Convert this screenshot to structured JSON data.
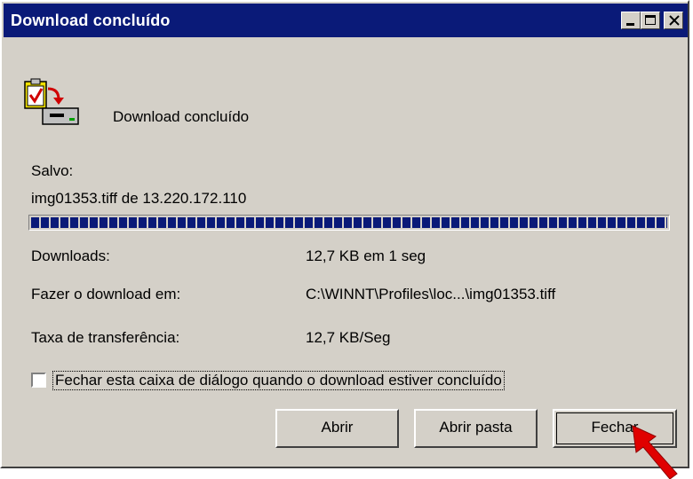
{
  "window": {
    "title": "Download concluído"
  },
  "header": {
    "label": "Download concluído",
    "icon": "download-complete-icon"
  },
  "saved": {
    "label": "Salvo:",
    "file": "img01353.tiff de 13.220.172.110"
  },
  "progress": {
    "percent": 100
  },
  "rows": [
    {
      "label": "Downloads:",
      "value": "12,7 KB em 1 seg"
    },
    {
      "label": "Fazer o download em:",
      "value": "C:\\WINNT\\Profiles\\loc...\\img01353.tiff"
    },
    {
      "label": "Taxa de transferência:",
      "value": "12,7 KB/Seg"
    }
  ],
  "checkbox": {
    "label": "Fechar esta caixa de diálogo quando o download estiver concluído",
    "checked": false
  },
  "buttons": {
    "open": "Abrir",
    "open_folder": "Abrir pasta",
    "close": "Fechar"
  },
  "colors": {
    "titlebar": "#0a1a78",
    "face": "#d4d0c8",
    "progress": "#0a1a78",
    "cursor": "#e00000"
  }
}
